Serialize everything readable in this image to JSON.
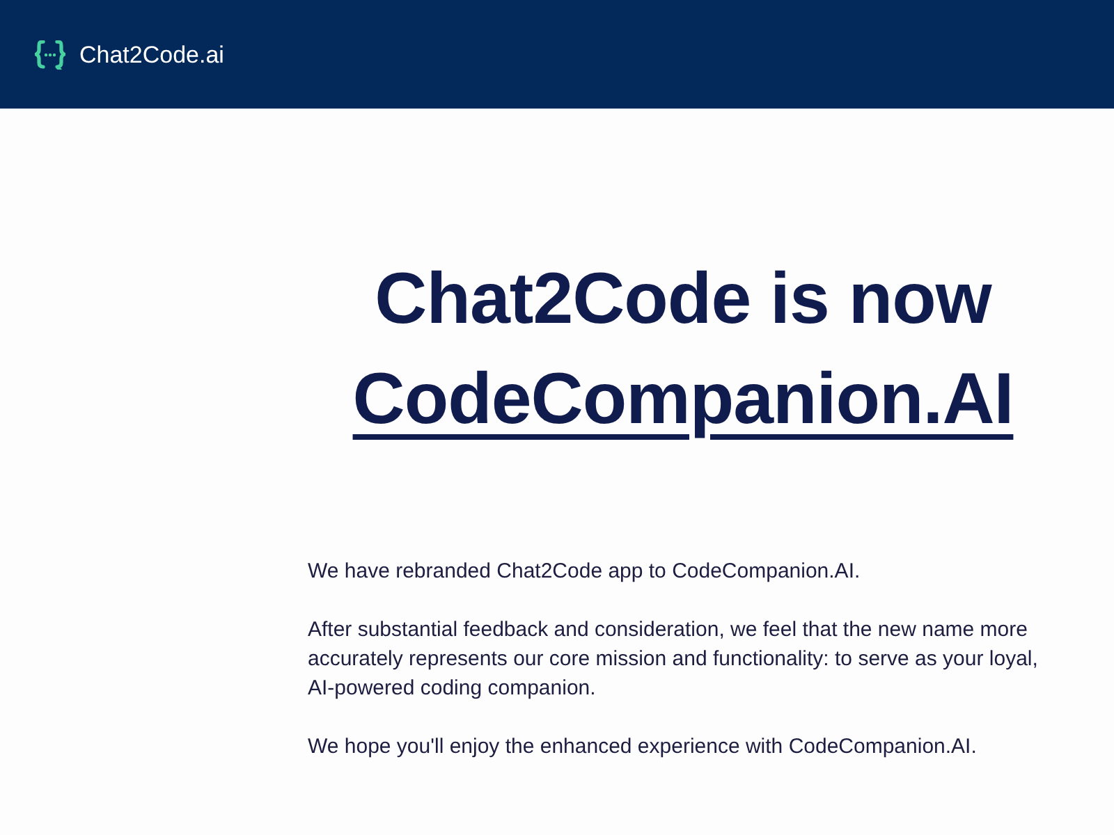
{
  "header": {
    "brand": "Chat2Code.ai"
  },
  "headline": {
    "text": "Chat2Code is now",
    "link": "CodeCompanion.AI"
  },
  "paragraphs": [
    "We have rebranded Chat2Code app to CodeCompanion.AI.",
    "After substantial feedback and consideration, we feel that the new name more accurately represents our core mission and functionality: to serve as your loyal, AI-powered coding companion.",
    "We hope you'll enjoy the enhanced experience with CodeCompanion.AI."
  ]
}
